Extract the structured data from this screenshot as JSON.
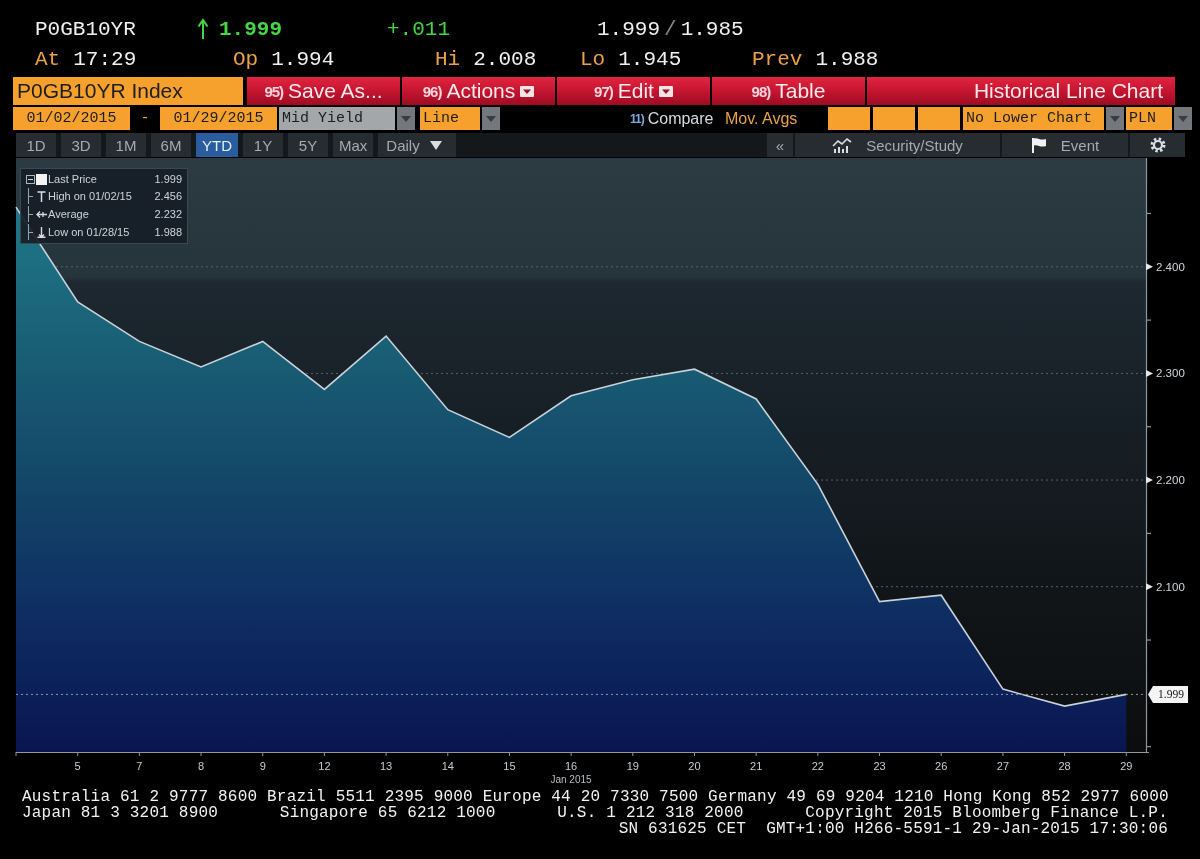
{
  "quote": {
    "ticker": "P0GB10YR",
    "rising": true,
    "last": "1.999",
    "change": "+.011",
    "bid": "1.999",
    "separator": "/",
    "ask": "1.985",
    "stats": [
      {
        "label": "At",
        "value": "17:29"
      },
      {
        "label": "Op",
        "value": "1.994"
      },
      {
        "label": "Hi",
        "value": "2.008"
      },
      {
        "label": "Lo",
        "value": "1.945"
      },
      {
        "label": "Prev",
        "value": "1.988"
      }
    ]
  },
  "toolbar": {
    "security": "P0GB10YR Index",
    "buttons": [
      {
        "number": "95)",
        "label": "Save As...",
        "dropdown": false
      },
      {
        "number": "96)",
        "label": "Actions",
        "dropdown": true
      },
      {
        "number": "97)",
        "label": "Edit",
        "dropdown": true
      },
      {
        "number": "98)",
        "label": "Table",
        "dropdown": false
      }
    ],
    "title": "Historical Line Chart"
  },
  "settings": {
    "start_date": "01/02/2015",
    "date_separator": "-",
    "end_date": "01/29/2015",
    "field": "Mid Yield",
    "chart_type": "Line",
    "compare": {
      "number": "11)",
      "label": "Compare"
    },
    "moving_averages": "Mov. Avgs",
    "lower_chart": "No Lower Chart",
    "currency": "PLN"
  },
  "periods": [
    {
      "label": "1D",
      "selected": false
    },
    {
      "label": "3D",
      "selected": false
    },
    {
      "label": "1M",
      "selected": false
    },
    {
      "label": "6M",
      "selected": false
    },
    {
      "label": "YTD",
      "selected": true
    },
    {
      "label": "1Y",
      "selected": false
    },
    {
      "label": "5Y",
      "selected": false
    },
    {
      "label": "Max",
      "selected": false
    }
  ],
  "frequency": "Daily",
  "tools": {
    "collapse": "«",
    "study": "Security/Study",
    "event": "Event"
  },
  "legend": {
    "last_value": "1.999",
    "stats": [
      {
        "kind": "high",
        "label": "High on 01/02/15",
        "value": "2.456"
      },
      {
        "kind": "average",
        "label": "Average",
        "value": "2.232"
      },
      {
        "kind": "low",
        "label": "Low on 01/28/15",
        "value": "1.988"
      }
    ]
  },
  "chart_data": {
    "type": "area",
    "xlabel": "Jan 2015",
    "categories": [
      null,
      "5",
      "7",
      "8",
      "9",
      "12",
      "13",
      "14",
      "15",
      "16",
      "19",
      "20",
      "21",
      "22",
      "23",
      "26",
      "27",
      "28",
      "29"
    ],
    "series": [
      {
        "name": "Last Price",
        "color": "#c8d2da",
        "values": [
          2.456,
          2.367,
          2.33,
          2.306,
          2.33,
          2.285,
          2.335,
          2.266,
          2.24,
          2.279,
          2.294,
          2.304,
          2.276,
          2.196,
          2.086,
          2.092,
          2.004,
          1.988,
          1.999
        ]
      }
    ],
    "ylim": [
      1.945,
      2.502
    ],
    "yticks": [
      {
        "value": 2.1,
        "label": "2.100"
      },
      {
        "value": 2.2,
        "label": "2.200"
      },
      {
        "value": 2.3,
        "label": "2.300"
      },
      {
        "value": 2.4,
        "label": "2.400"
      }
    ],
    "grid": true,
    "ref_lines": [
      {
        "axis": "y",
        "value": 1.999,
        "label": "1.999"
      }
    ]
  },
  "footer": {
    "lines": [
      [
        "Australia 61 2 9777 8600 Brazil 5511 2395 9000 Europe 44 20 7330 7500 Germany 49 69 9204 1210 Hong Kong 852 2977 6000"
      ],
      [
        "Japan 81 3 3201 8900",
        "Singapore 65 6212 1000",
        "U.S. 1 212 318 2000",
        "Copyright 2015 Bloomberg Finance L.P."
      ],
      [
        "SN 631625 CET",
        "GMT+1:00 H266-5591-1 29-Jan-2015 17:30:06"
      ]
    ]
  }
}
